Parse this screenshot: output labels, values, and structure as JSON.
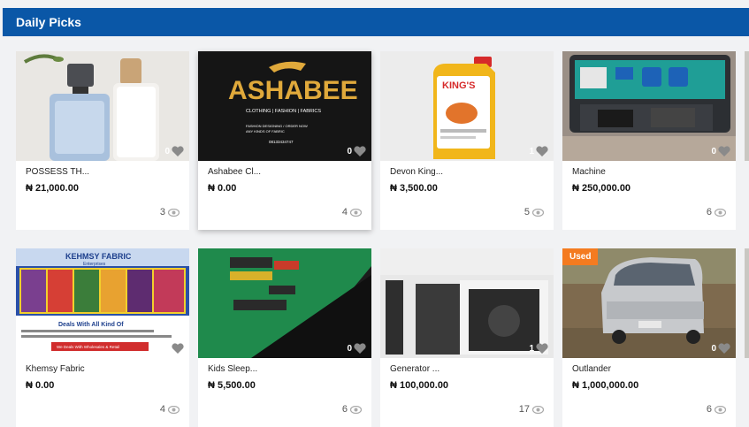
{
  "section": {
    "title": "Daily Picks"
  },
  "products": [
    {
      "name": "POSSESS TH...",
      "price": "₦ 21,000.00",
      "likes": "0",
      "views": "3"
    },
    {
      "name": "Ashabee Cl...",
      "price": "₦ 0.00",
      "likes": "0",
      "views": "4",
      "brand": {
        "logo_text": "ASHABEE",
        "tagline": "CLOTHING  |  FASHION  |  FABRICS",
        "line1": "FASHION DESIGNING / ORDER NOW",
        "line2": "ANY KINDS OF FABRIC",
        "phone": "08133434747"
      }
    },
    {
      "name": "Devon King...",
      "price": "₦ 3,500.00",
      "likes": "1",
      "views": "5",
      "label": "KING'S"
    },
    {
      "name": "Machine",
      "price": "₦ 250,000.00",
      "likes": "0",
      "views": "6"
    },
    {
      "name": "Khemsy Fabric",
      "price": "₦ 0.00",
      "likes": "0",
      "views": "4",
      "banner": {
        "title": "KEHMSY FABRIC",
        "subtitle": "Enterprises",
        "deals": "Deals With All Kind Of",
        "cta": "We Deals With Wholesales & Retail"
      }
    },
    {
      "name": "Kids Sleep...",
      "price": "₦ 5,500.00",
      "likes": "0",
      "views": "6"
    },
    {
      "name": "Generator ...",
      "price": "₦ 100,000.00",
      "likes": "1",
      "views": "17"
    },
    {
      "name": "Outlander",
      "price": "₦ 1,000,000.00",
      "likes": "0",
      "views": "6",
      "badge": "Used"
    }
  ],
  "colors": {
    "header": "#0a57a7",
    "badge": "#f47b20"
  }
}
